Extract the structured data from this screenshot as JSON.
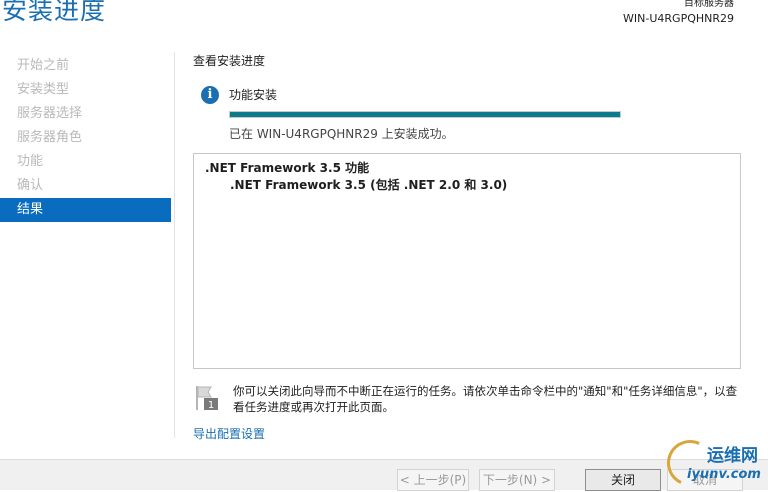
{
  "header": {
    "title": "安装进度",
    "target_server_label": "目标服务器",
    "target_server_name": "WIN-U4RGPQHNR29"
  },
  "nav": {
    "items": [
      {
        "label": "开始之前",
        "active": false
      },
      {
        "label": "安装类型",
        "active": false
      },
      {
        "label": "服务器选择",
        "active": false
      },
      {
        "label": "服务器角色",
        "active": false
      },
      {
        "label": "功能",
        "active": false
      },
      {
        "label": "确认",
        "active": false
      },
      {
        "label": "结果",
        "active": true
      }
    ]
  },
  "main": {
    "section_heading": "查看安装进度",
    "info_icon_glyph": "i",
    "progress": {
      "label": "功能安装",
      "value_percent": 100,
      "status": "已在 WIN-U4RGPQHNR29 上安装成功。"
    },
    "results": {
      "feature": ".NET Framework 3.5 功能",
      "sub_feature": ".NET Framework 3.5 (包括 .NET 2.0 和 3.0)"
    },
    "note": {
      "icon": "flag-notification-icon",
      "badge": "1",
      "text": "你可以关闭此向导而不中断正在运行的任务。请依次单击命令栏中的\"通知\"和\"任务详细信息\"，以查看任务进度或再次打开此页面。"
    },
    "export_link": "导出配置设置"
  },
  "footer": {
    "prev_label": "< 上一步(P)",
    "next_label": "下一步(N) >",
    "close_label": "关闭",
    "cancel_label": "取消"
  },
  "watermark": {
    "top": "运维网",
    "bottom": "iyunv.com"
  },
  "colors": {
    "accent": "#1a6fb3",
    "nav_active": "#0a6cbf",
    "progress": "#0e7a8d"
  }
}
